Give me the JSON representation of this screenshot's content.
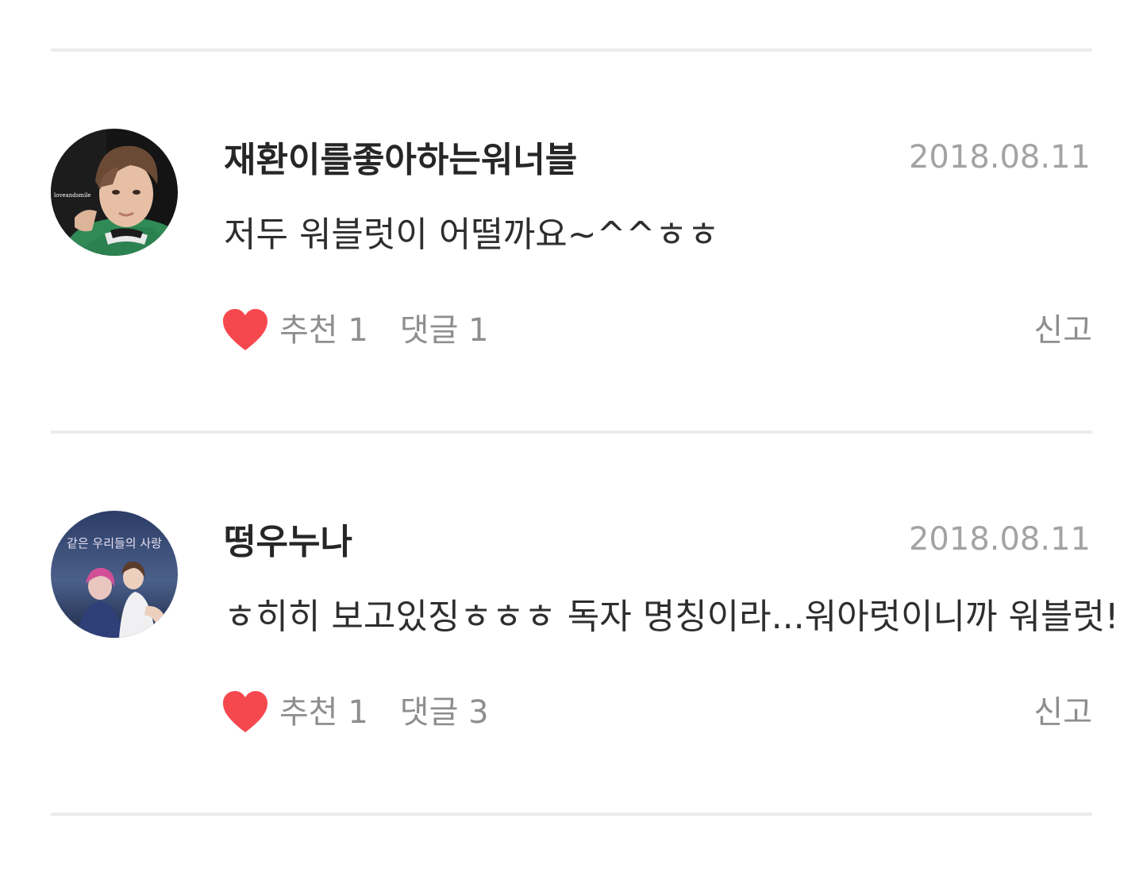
{
  "comments": [
    {
      "author": "재환이를좋아하는워너블",
      "date": "2018.08.11",
      "text": "저두 워블럿이 어떨까요~^^ㅎㅎ",
      "recommend_label": "추천 1",
      "reply_label": "댓글 1",
      "report_label": "신고",
      "avatar_icon": "profile-photo"
    },
    {
      "author": "떵우누나",
      "date": "2018.08.11",
      "text": "ㅎ히히 보고있징ㅎㅎㅎ 독자 명칭이라...워아럿이니까 워블럿!",
      "recommend_label": "추천 1",
      "reply_label": "댓글 3",
      "report_label": "신고",
      "avatar_icon": "profile-photo",
      "avatar_caption": "같은 우리들의 사랑"
    }
  ],
  "colors": {
    "heart": "#f5484e",
    "divider": "#ececec",
    "meta_text": "#8e8e8e",
    "date_text": "#a3a3a3"
  }
}
